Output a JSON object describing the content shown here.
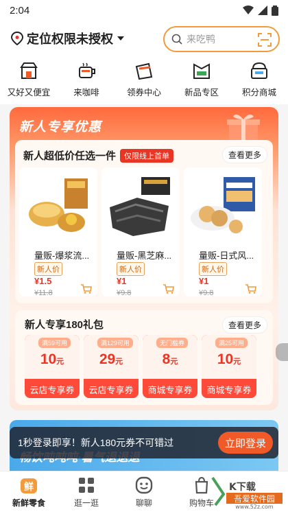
{
  "status": {
    "time": "2:04"
  },
  "header": {
    "location": "定位权限未授权",
    "search_placeholder": "来吃鸭"
  },
  "quick_entries": [
    {
      "label": "又好又便宜",
      "icon": "store-icon"
    },
    {
      "label": "来咖啡",
      "icon": "coffee-icon"
    },
    {
      "label": "领券中心",
      "icon": "coupon-icon"
    },
    {
      "label": "新品专区",
      "icon": "new-bag-icon"
    },
    {
      "label": "积分商城",
      "icon": "points-mall-icon"
    }
  ],
  "promo": {
    "title": "新人专享优惠",
    "section1": {
      "title": "新人超低价任选一件",
      "badge": "仅限线上首单",
      "more": "查看更多",
      "products": [
        {
          "name": "量贩-爆浆流心",
          "name_display": "量贩-爆浆流...",
          "tag": "新人价",
          "price": "¥1.5",
          "orig": "¥11.8"
        },
        {
          "name": "量贩-黑芝麻",
          "name_display": "量贩-黑芝麻...",
          "tag": "新人价",
          "price": "¥1",
          "orig": "¥9.8"
        },
        {
          "name": "量贩-日式风",
          "name_display": "量贩-日式风...",
          "tag": "新人价",
          "price": "¥1",
          "orig": "¥9.8"
        }
      ]
    },
    "section2": {
      "title": "新人专享180礼包",
      "more": "查看更多",
      "coupons": [
        {
          "cond": "满59可用",
          "amount": "10",
          "unit": "元",
          "label": "云店专享券"
        },
        {
          "cond": "满129可用",
          "amount": "29",
          "unit": "元",
          "label": "云店专享券"
        },
        {
          "cond": "无门槛券",
          "amount": "8",
          "unit": "元",
          "label": "商城专享券"
        },
        {
          "cond": "满25可用",
          "amount": "10",
          "unit": "元",
          "label": "商城专享券"
        }
      ]
    }
  },
  "banner2": {
    "text": "畅饮吨吨吨·暑气退退退"
  },
  "login_bar": {
    "message": "1秒登录即享！新人180元券不可错过",
    "button": "立即登录"
  },
  "tabs": [
    {
      "label": "新鲜零食",
      "icon": "fresh-icon",
      "active": true
    },
    {
      "label": "逛一逛",
      "icon": "grid-icon"
    },
    {
      "label": "聊聊",
      "icon": "chat-icon"
    },
    {
      "label": "购物车",
      "icon": "cart-icon"
    }
  ],
  "watermark": {
    "text": "吾爱软件园",
    "url": "www.52z.com"
  },
  "colors": {
    "accent": "#f05a28",
    "red": "#e93524",
    "orange_border": "#f39a3a"
  }
}
